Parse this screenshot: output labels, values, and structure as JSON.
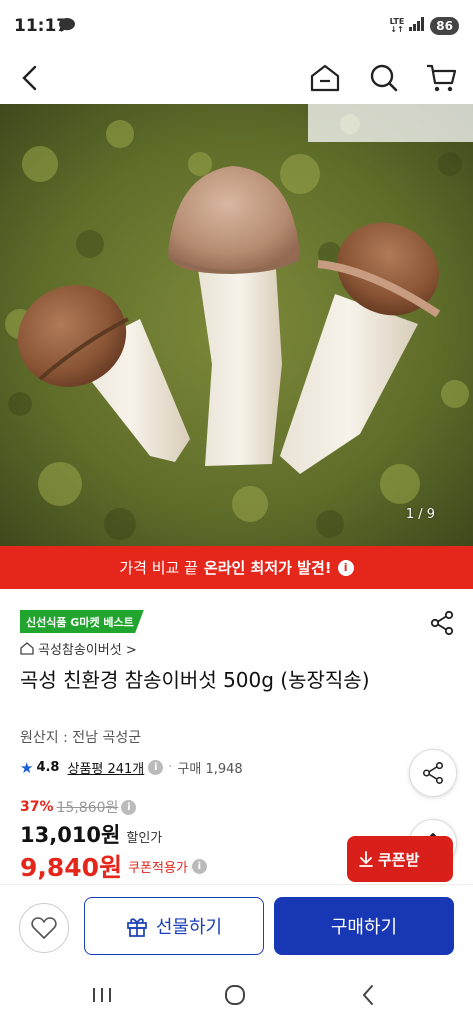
{
  "status_bar": {
    "time": "11:17",
    "network": "LTE",
    "battery": "86"
  },
  "top_nav": {
    "icons": [
      "back-icon",
      "home-icon",
      "search-icon",
      "cart-icon"
    ]
  },
  "hero": {
    "counter": "1 / 9"
  },
  "promo": {
    "text": "가격 비교 끝",
    "bold_text": "온라인 최저가 발견!",
    "info": "i"
  },
  "product": {
    "badge": "신선식품 G마켓 베스트",
    "store_link": "곡성참송이버섯 >",
    "title": "곡성 친환경 참송이버섯 500g (농장직송)",
    "origin": "원산지 : 전남 곡성군",
    "rating": "4.8",
    "reviews": "상품평 241개",
    "purchase_count": "구매 1,948"
  },
  "price": {
    "discount_pct": "37%",
    "original": "15,860원",
    "sale": "13,010원",
    "sale_label": "할인가",
    "coupon_price": "9,840원",
    "coupon_label": "쿠폰적용가"
  },
  "buttons": {
    "coupon": "쿠폰받",
    "gift": "선물하기",
    "buy": "구매하기"
  },
  "colors": {
    "accent_red": "#e5261b",
    "accent_blue": "#1837b5",
    "badge_green": "#21a52e"
  }
}
